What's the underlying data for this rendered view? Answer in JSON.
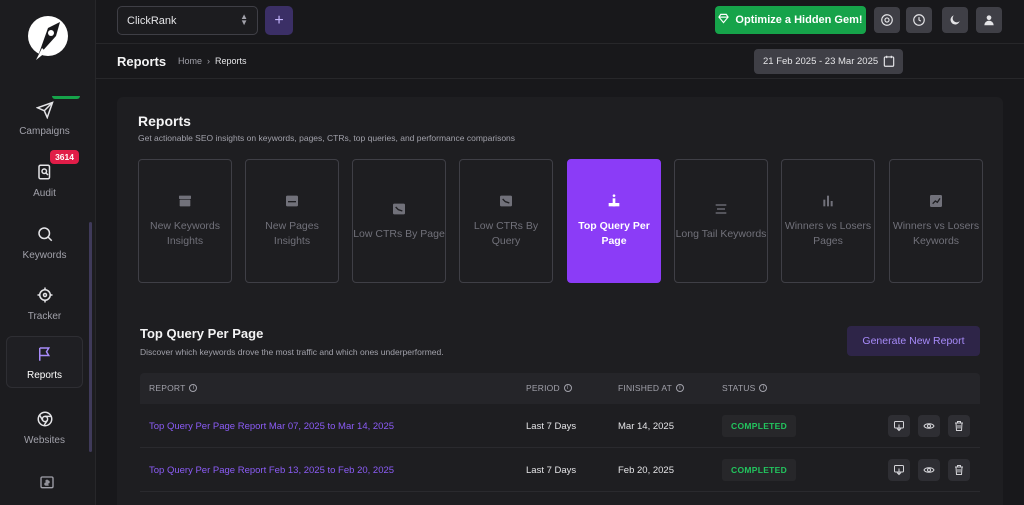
{
  "topbar": {
    "site": "ClickRank",
    "plus": "+",
    "gem_button": "Optimize a Hidden Gem!"
  },
  "sidebar": {
    "items": [
      {
        "label": "Campaigns",
        "icon": "paper-plane-icon"
      },
      {
        "label": "Audit",
        "icon": "audit-search-icon",
        "badge": "3614"
      },
      {
        "label": "Keywords",
        "icon": "search-icon"
      },
      {
        "label": "Tracker",
        "icon": "crosshair-icon"
      },
      {
        "label": "Reports",
        "icon": "flag-icon",
        "active": true
      },
      {
        "label": "Websites",
        "icon": "globe-icon"
      }
    ]
  },
  "subheader": {
    "title": "Reports",
    "breadcrumb": [
      "Home",
      "Reports"
    ],
    "date_range": "21 Feb 2025 - 23 Mar 2025"
  },
  "main": {
    "title": "Reports",
    "subtitle": "Get actionable SEO insights on keywords, pages, CTRs, top queries, and performance comparisons",
    "tiles": [
      {
        "label": "New Keywords Insights"
      },
      {
        "label": "New Pages Insights"
      },
      {
        "label": "Low CTRs By Page"
      },
      {
        "label": "Low CTRs By Query"
      },
      {
        "label": "Top Query Per Page",
        "active": true
      },
      {
        "label": "Long Tail Keywords"
      },
      {
        "label": "Winners vs Losers Pages"
      },
      {
        "label": "Winners vs Losers Keywords"
      }
    ],
    "section_title": "Top Query Per Page",
    "section_subtitle": "Discover which keywords drove the most traffic and which ones underperformed.",
    "generate_button": "Generate New Report"
  },
  "table": {
    "headers": {
      "report": "REPORT",
      "period": "PERIOD",
      "finished_at": "FINISHED AT",
      "status": "STATUS"
    },
    "rows": [
      {
        "report": "Top Query Per Page Report Mar 07, 2025 to Mar 14, 2025",
        "period": "Last 7 Days",
        "finished_at": "Mar 14, 2025",
        "status": "COMPLETED"
      },
      {
        "report": "Top Query Per Page Report Feb 13, 2025 to Feb 20, 2025",
        "period": "Last 7 Days",
        "finished_at": "Feb 20, 2025",
        "status": "COMPLETED"
      }
    ]
  },
  "colors": {
    "accent": "#8b3cf7",
    "success": "#16a34a",
    "badge": "#e11d48",
    "background": "#18181b"
  }
}
